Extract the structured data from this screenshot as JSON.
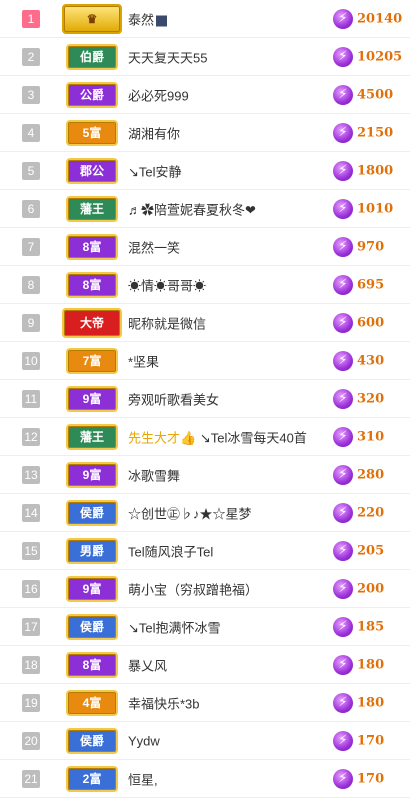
{
  "colors": {
    "rank_top": "#ff6b8a",
    "rank_default": "#bdbdbd",
    "score": "#e0700a",
    "badge_blue": "#3a6fd8",
    "badge_green": "#2e8b57",
    "badge_purple": "#8d2fd6",
    "badge_orange": "#e88a10",
    "badge_red": "#d81e1e"
  },
  "rows": [
    {
      "rank": "1",
      "badge": "",
      "badge_style": "crown",
      "name": "泰然",
      "name_suffix_icon": "speaker-icon",
      "score": "20140"
    },
    {
      "rank": "2",
      "badge": "伯爵",
      "badge_style": "green",
      "name": "天天复天天55",
      "score": "10205"
    },
    {
      "rank": "3",
      "badge": "公爵",
      "badge_style": "purple",
      "name": "必必死999",
      "score": "4500"
    },
    {
      "rank": "4",
      "badge": "5富",
      "badge_style": "orange",
      "name": "湖湘有你",
      "score": "2150"
    },
    {
      "rank": "5",
      "badge": "郡公",
      "badge_style": "purple",
      "name": "↘Tel安静",
      "score": "1800"
    },
    {
      "rank": "6",
      "badge": "藩王",
      "badge_style": "green",
      "name": "♬✿陪萱妮春夏秋冬❤",
      "score": "1010"
    },
    {
      "rank": "7",
      "badge": "8富",
      "badge_style": "purple",
      "name": "混然一笑",
      "score": "970"
    },
    {
      "rank": "8",
      "badge": "8富",
      "badge_style": "purple",
      "name": "☀情☀哥哥☀",
      "score": "695"
    },
    {
      "rank": "9",
      "badge": "大帝",
      "badge_style": "red",
      "name": "昵称就是微信",
      "score": "600"
    },
    {
      "rank": "10",
      "badge": "7富",
      "badge_style": "orange",
      "name": "*坚果",
      "score": "430"
    },
    {
      "rank": "11",
      "badge": "9富",
      "badge_style": "purple",
      "name": "旁观听歌看美女",
      "score": "320"
    },
    {
      "rank": "12",
      "badge": "藩王",
      "badge_style": "green",
      "name": "先生大才",
      "name_tail": "↘Tel冰雪每天40首",
      "score": "310"
    },
    {
      "rank": "13",
      "badge": "9富",
      "badge_style": "purple",
      "name": "冰歌雪舞",
      "score": "280"
    },
    {
      "rank": "14",
      "badge": "侯爵",
      "badge_style": "blue",
      "name": "☆创世㊣♭♪★☆星梦",
      "score": "220"
    },
    {
      "rank": "15",
      "badge": "男爵",
      "badge_style": "blue",
      "name": "Tel随风浪子Tel",
      "score": "205"
    },
    {
      "rank": "16",
      "badge": "9富",
      "badge_style": "purple",
      "name": "萌小宝（穷叔蹭艳福）",
      "score": "200"
    },
    {
      "rank": "17",
      "badge": "侯爵",
      "badge_style": "blue",
      "name": "↘Tel抱满怀冰雪",
      "score": "185"
    },
    {
      "rank": "18",
      "badge": "8富",
      "badge_style": "purple",
      "name": "暴乂风",
      "score": "180"
    },
    {
      "rank": "19",
      "badge": "4富",
      "badge_style": "orange",
      "name": "幸福快乐*3b",
      "score": "180"
    },
    {
      "rank": "20",
      "badge": "侯爵",
      "badge_style": "blue",
      "name": "Yydw",
      "score": "170"
    },
    {
      "rank": "21",
      "badge": "2富",
      "badge_style": "blue",
      "name": "恒星,",
      "score": "170"
    }
  ]
}
